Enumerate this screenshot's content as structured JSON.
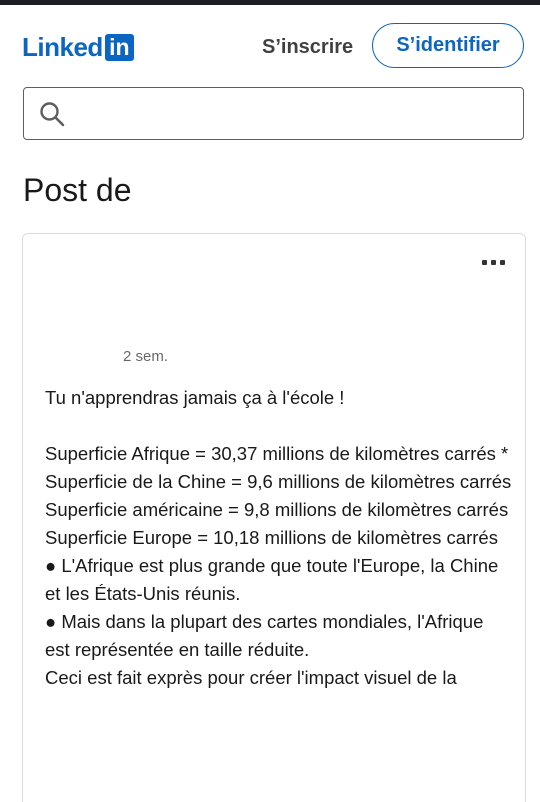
{
  "header": {
    "logo_text": "Linked",
    "logo_box": "in",
    "signup_label": "S’inscrire",
    "signin_label": "S’identifier"
  },
  "search": {
    "value": "",
    "placeholder": ""
  },
  "page_title": "Post de",
  "post": {
    "timestamp": "2 sem.",
    "lines": [
      "Tu n'apprendras jamais ça à l'école !",
      "",
      "Superficie Afrique = 30,37 millions de kilomètres carrés *",
      "Superficie de la Chine = 9,6 millions de kilomètres carrés",
      "Superficie américaine = 9,8 millions de kilomètres carrés",
      "Superficie Europe = 10,18 millions de kilomètres carrés",
      "● L'Afrique est plus grande que toute l'Europe, la Chine et les États-Unis réunis.",
      "● Mais dans la plupart des cartes mondiales, l'Afrique est représentée en taille réduite.",
      "Ceci est fait exprès pour créer l'impact visuel de la"
    ]
  },
  "colors": {
    "brand": "#0a66c2",
    "top_bar": "#1b1f23"
  },
  "icons": {
    "search": "search-icon",
    "more": "more-options-icon"
  }
}
